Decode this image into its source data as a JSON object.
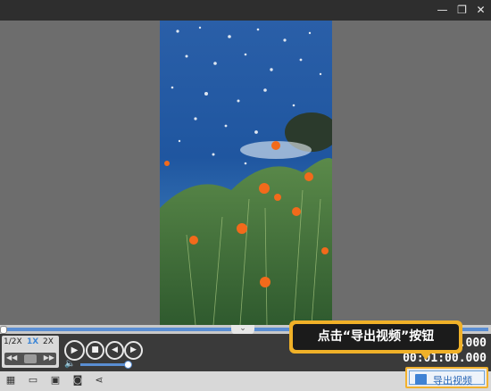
{
  "window": {
    "minimize_glyph": "—",
    "restore_glyph": "❐",
    "close_glyph": "✕"
  },
  "playback": {
    "speeds": [
      "1/2X",
      "1X",
      "2X"
    ],
    "active_speed": "1X",
    "volume_level": 0.95,
    "seek_position": 0.0,
    "current_time": "00:00:00.000",
    "total_time": "00:01:00.000",
    "collapse_glyph": "⌄"
  },
  "toolbar": {
    "export_label": "导出视频"
  },
  "annotation": {
    "callout_text": "点击“导出视频”按钮"
  },
  "colors": {
    "accent": "#5a8ed3",
    "highlight": "#f0b128"
  },
  "icons": [
    "minimize-icon",
    "restore-icon",
    "close-icon",
    "play-icon",
    "stop-icon",
    "prev-frame-icon",
    "next-frame-icon",
    "volume-icon",
    "share-icon",
    "export-icon"
  ]
}
